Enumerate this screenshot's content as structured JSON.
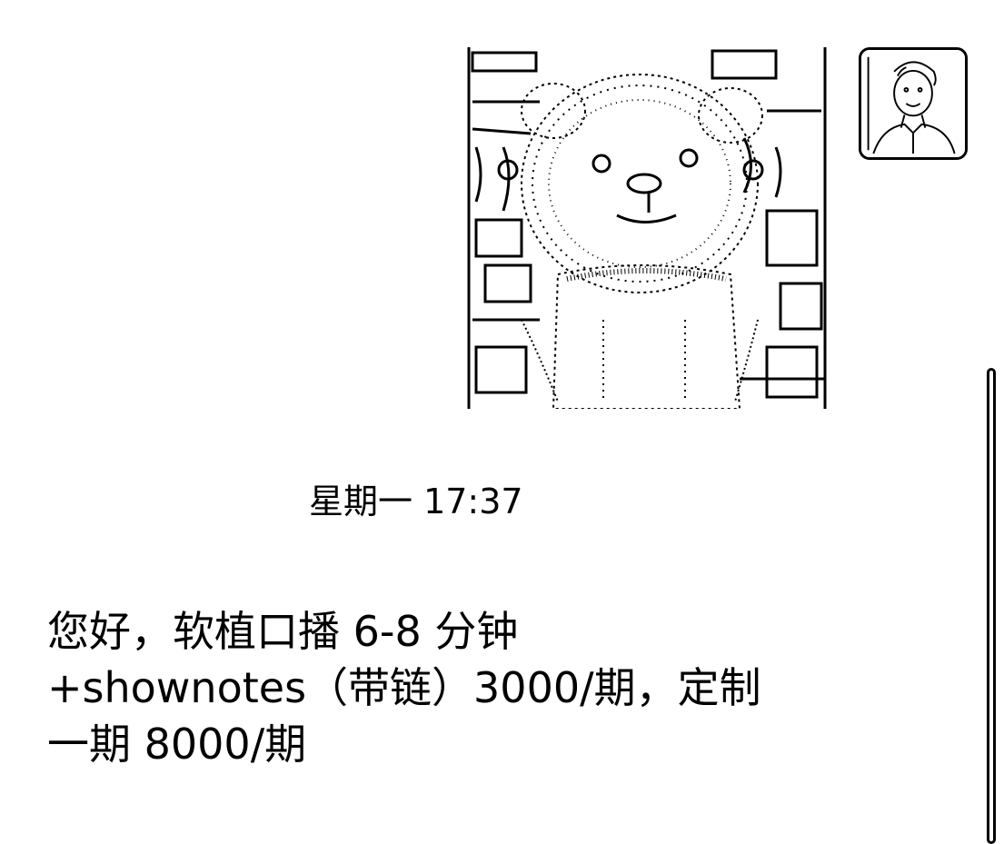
{
  "conversation": {
    "timestamp": "星期一 17:37",
    "message_lines": [
      "您好，软植口播 6-8 分钟",
      "+shownotes（带链）3000/期，定制",
      "一期 8000/期"
    ]
  },
  "icons": {
    "sent_image": "teddy-bear-photo",
    "avatar": "user-avatar-photo"
  },
  "colors": {
    "background": "#ffffff",
    "foreground": "#000000"
  }
}
